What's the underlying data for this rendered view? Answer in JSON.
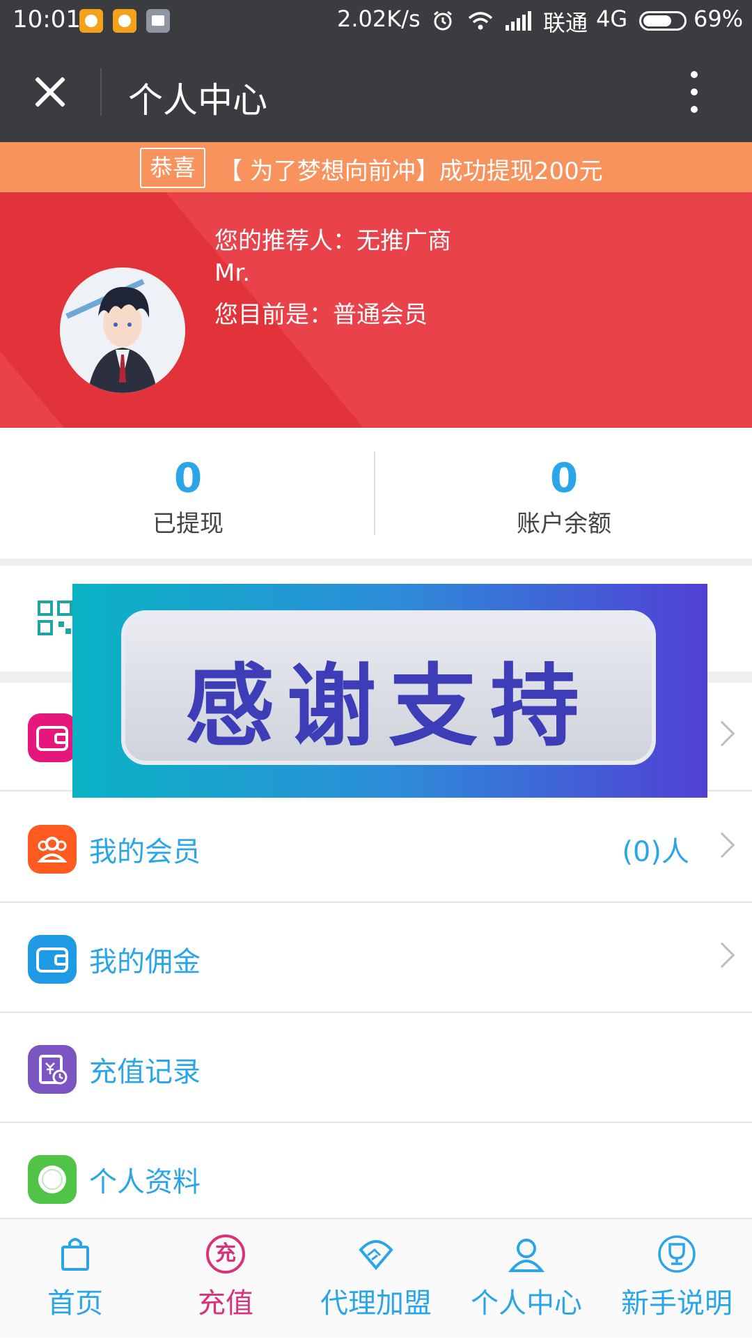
{
  "status_bar": {
    "time": "10:01",
    "network_speed": "2.02K/s",
    "carrier": "联通",
    "network_type": "4G",
    "battery": "69%"
  },
  "header": {
    "title": "个人中心"
  },
  "announcement": {
    "tag": "恭喜",
    "text": "【 为了梦想向前冲】成功提现200元"
  },
  "profile": {
    "referrer_line": "您的推荐人：无推广商",
    "name": "Mr.",
    "level_line": "您目前是：普通会员"
  },
  "stats": [
    {
      "value": "0",
      "label": "已提现"
    },
    {
      "value": "0",
      "label": "账户余额"
    }
  ],
  "menu": [
    {
      "label": "",
      "value": "",
      "icon": "wallet-icon",
      "color": "#e5177d"
    },
    {
      "label": "我的会员",
      "value": "(0)人",
      "icon": "members-icon",
      "color": "#ff5a1f"
    },
    {
      "label": "我的佣金",
      "value": "",
      "icon": "wallet-icon",
      "color": "#1f9be6"
    },
    {
      "label": "充值记录",
      "value": "",
      "icon": "recharge-record-icon",
      "color": "#7b55c2"
    },
    {
      "label": "个人资料",
      "value": "",
      "icon": "profile-icon",
      "color": "#4fc447"
    }
  ],
  "popup": {
    "text": "感谢支持"
  },
  "bottom_nav": [
    {
      "label": "首页",
      "icon": "shopping-bag-icon"
    },
    {
      "label": "充值",
      "icon": "recharge-icon",
      "icon_text": "充",
      "active": true
    },
    {
      "label": "代理加盟",
      "icon": "handshake-icon"
    },
    {
      "label": "个人中心",
      "icon": "user-icon"
    },
    {
      "label": "新手说明",
      "icon": "trophy-icon"
    }
  ],
  "colors": {
    "header_bg": "#3b3c40",
    "announce_bg": "#f8935e",
    "banner_bg": "#e9424b",
    "accent_blue": "#2aa5e8",
    "active_nav": "#d9327a"
  }
}
